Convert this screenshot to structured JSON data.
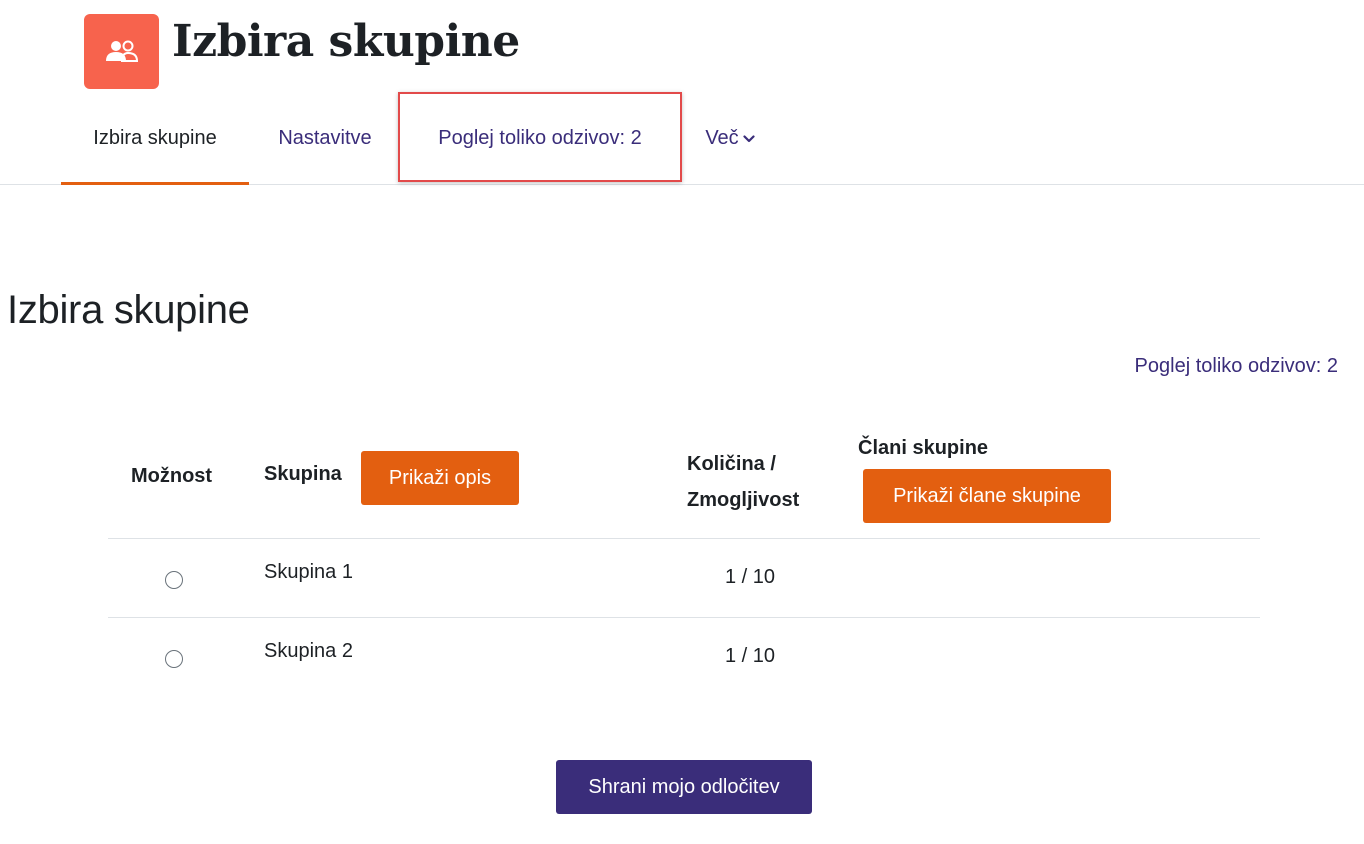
{
  "header": {
    "icon": "group-choice-icon",
    "icon_color": "#f7634d",
    "title": "Izbira skupine"
  },
  "secondary_nav": {
    "tabs": [
      {
        "label": "Izbira skupine",
        "selected": true
      },
      {
        "label": "Nastavitve",
        "selected": false
      },
      {
        "label": "Poglej toliko odzivov: 2",
        "selected": false
      },
      {
        "label": "Več",
        "selected": false
      }
    ],
    "accent_color": "#e35f10",
    "link_color": "#3a2d7a"
  },
  "main": {
    "heading": "Izbira skupine",
    "responses_link": "Poglej toliko odzivov: 2",
    "table": {
      "headers": {
        "option": "Možnost",
        "group": "Skupina",
        "quantity_line1": "Količina /",
        "quantity_line2": "Zmogljivost",
        "members": "Člani skupine"
      },
      "show_description_button": "Prikaži opis",
      "show_members_button": "Prikaži člane skupine",
      "rows": [
        {
          "group": "Skupina 1",
          "quantity": "1 / 10",
          "selected": false
        },
        {
          "group": "Skupina 2",
          "quantity": "1 / 10",
          "selected": false
        }
      ]
    },
    "save_button": "Shrani mojo odločitev"
  }
}
